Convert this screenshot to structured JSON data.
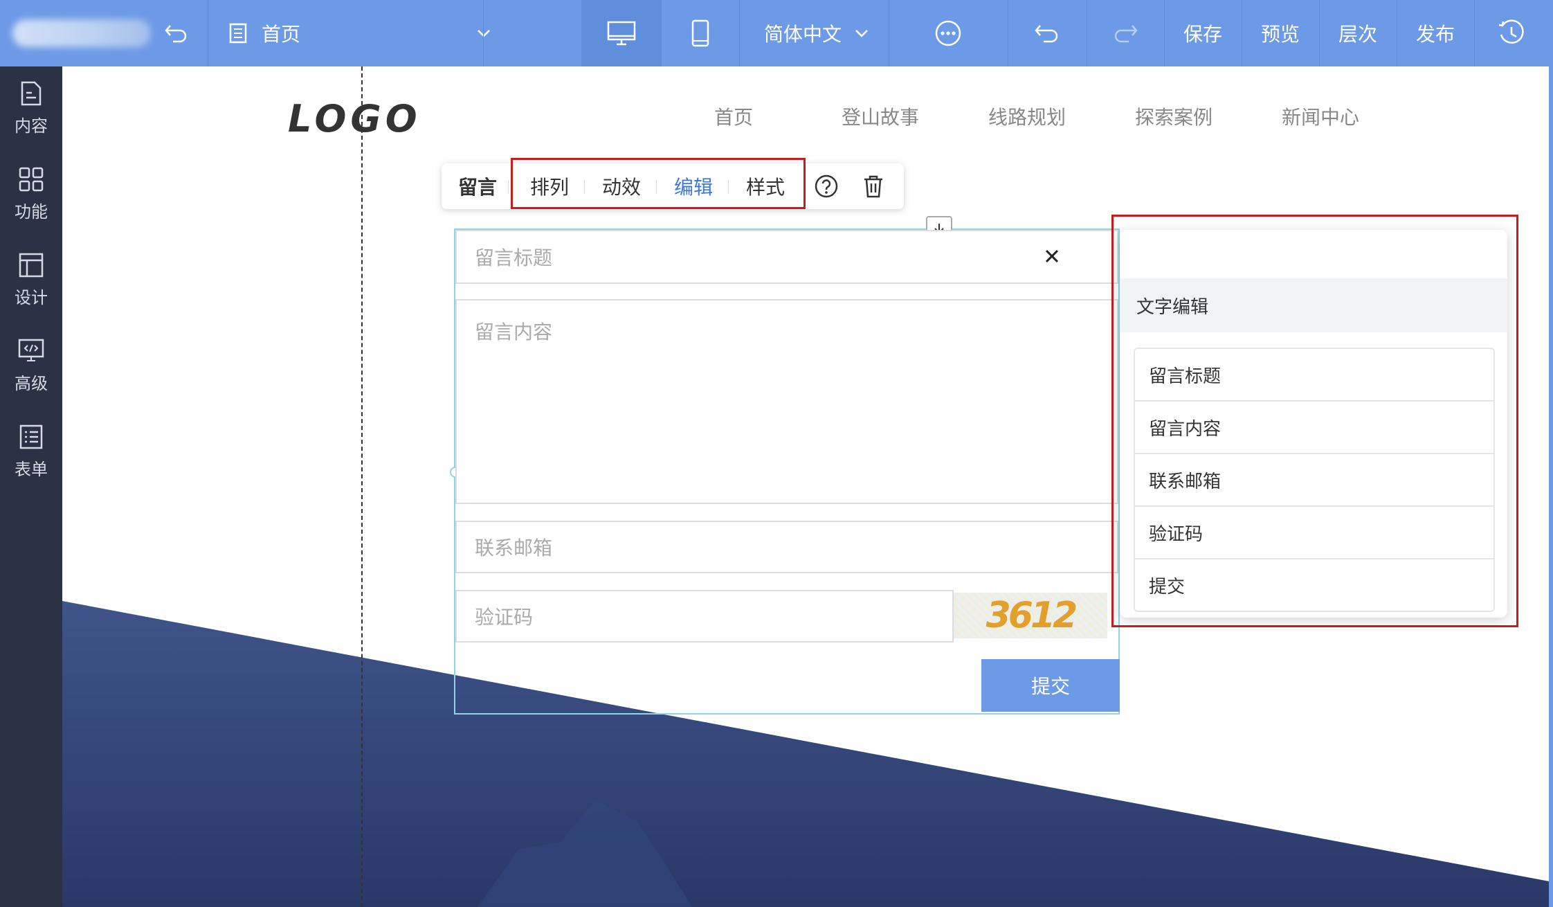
{
  "topbar": {
    "page_select": "首页",
    "language": "简体中文",
    "save": "保存",
    "preview": "预览",
    "layers": "层次",
    "publish": "发布"
  },
  "sidebar": {
    "items": [
      {
        "label": "内容",
        "icon": "document-icon"
      },
      {
        "label": "功能",
        "icon": "grid-icon"
      },
      {
        "label": "设计",
        "icon": "layout-icon"
      },
      {
        "label": "高级",
        "icon": "code-monitor-icon"
      },
      {
        "label": "表单",
        "icon": "list-icon"
      }
    ]
  },
  "site": {
    "logo": "LOGO",
    "nav": [
      "首页",
      "登山故事",
      "线路规划",
      "探索案例",
      "新闻中心"
    ]
  },
  "toolbar": {
    "module_name": "留言",
    "arrange": "排列",
    "animation": "动效",
    "edit": "编辑",
    "style": "样式"
  },
  "form": {
    "title_placeholder": "留言标题",
    "content_placeholder": "留言内容",
    "email_placeholder": "联系邮箱",
    "captcha_placeholder": "验证码",
    "captcha_text": "3612",
    "submit": "提交"
  },
  "panel": {
    "heading": "文字编辑",
    "items": [
      "留言标题",
      "留言内容",
      "联系邮箱",
      "验证码",
      "提交"
    ]
  },
  "colors": {
    "accent": "#6d9ae6",
    "sidebar": "#2b3243",
    "highlight": "#c51d1d",
    "active_tool": "#3a78e0"
  }
}
